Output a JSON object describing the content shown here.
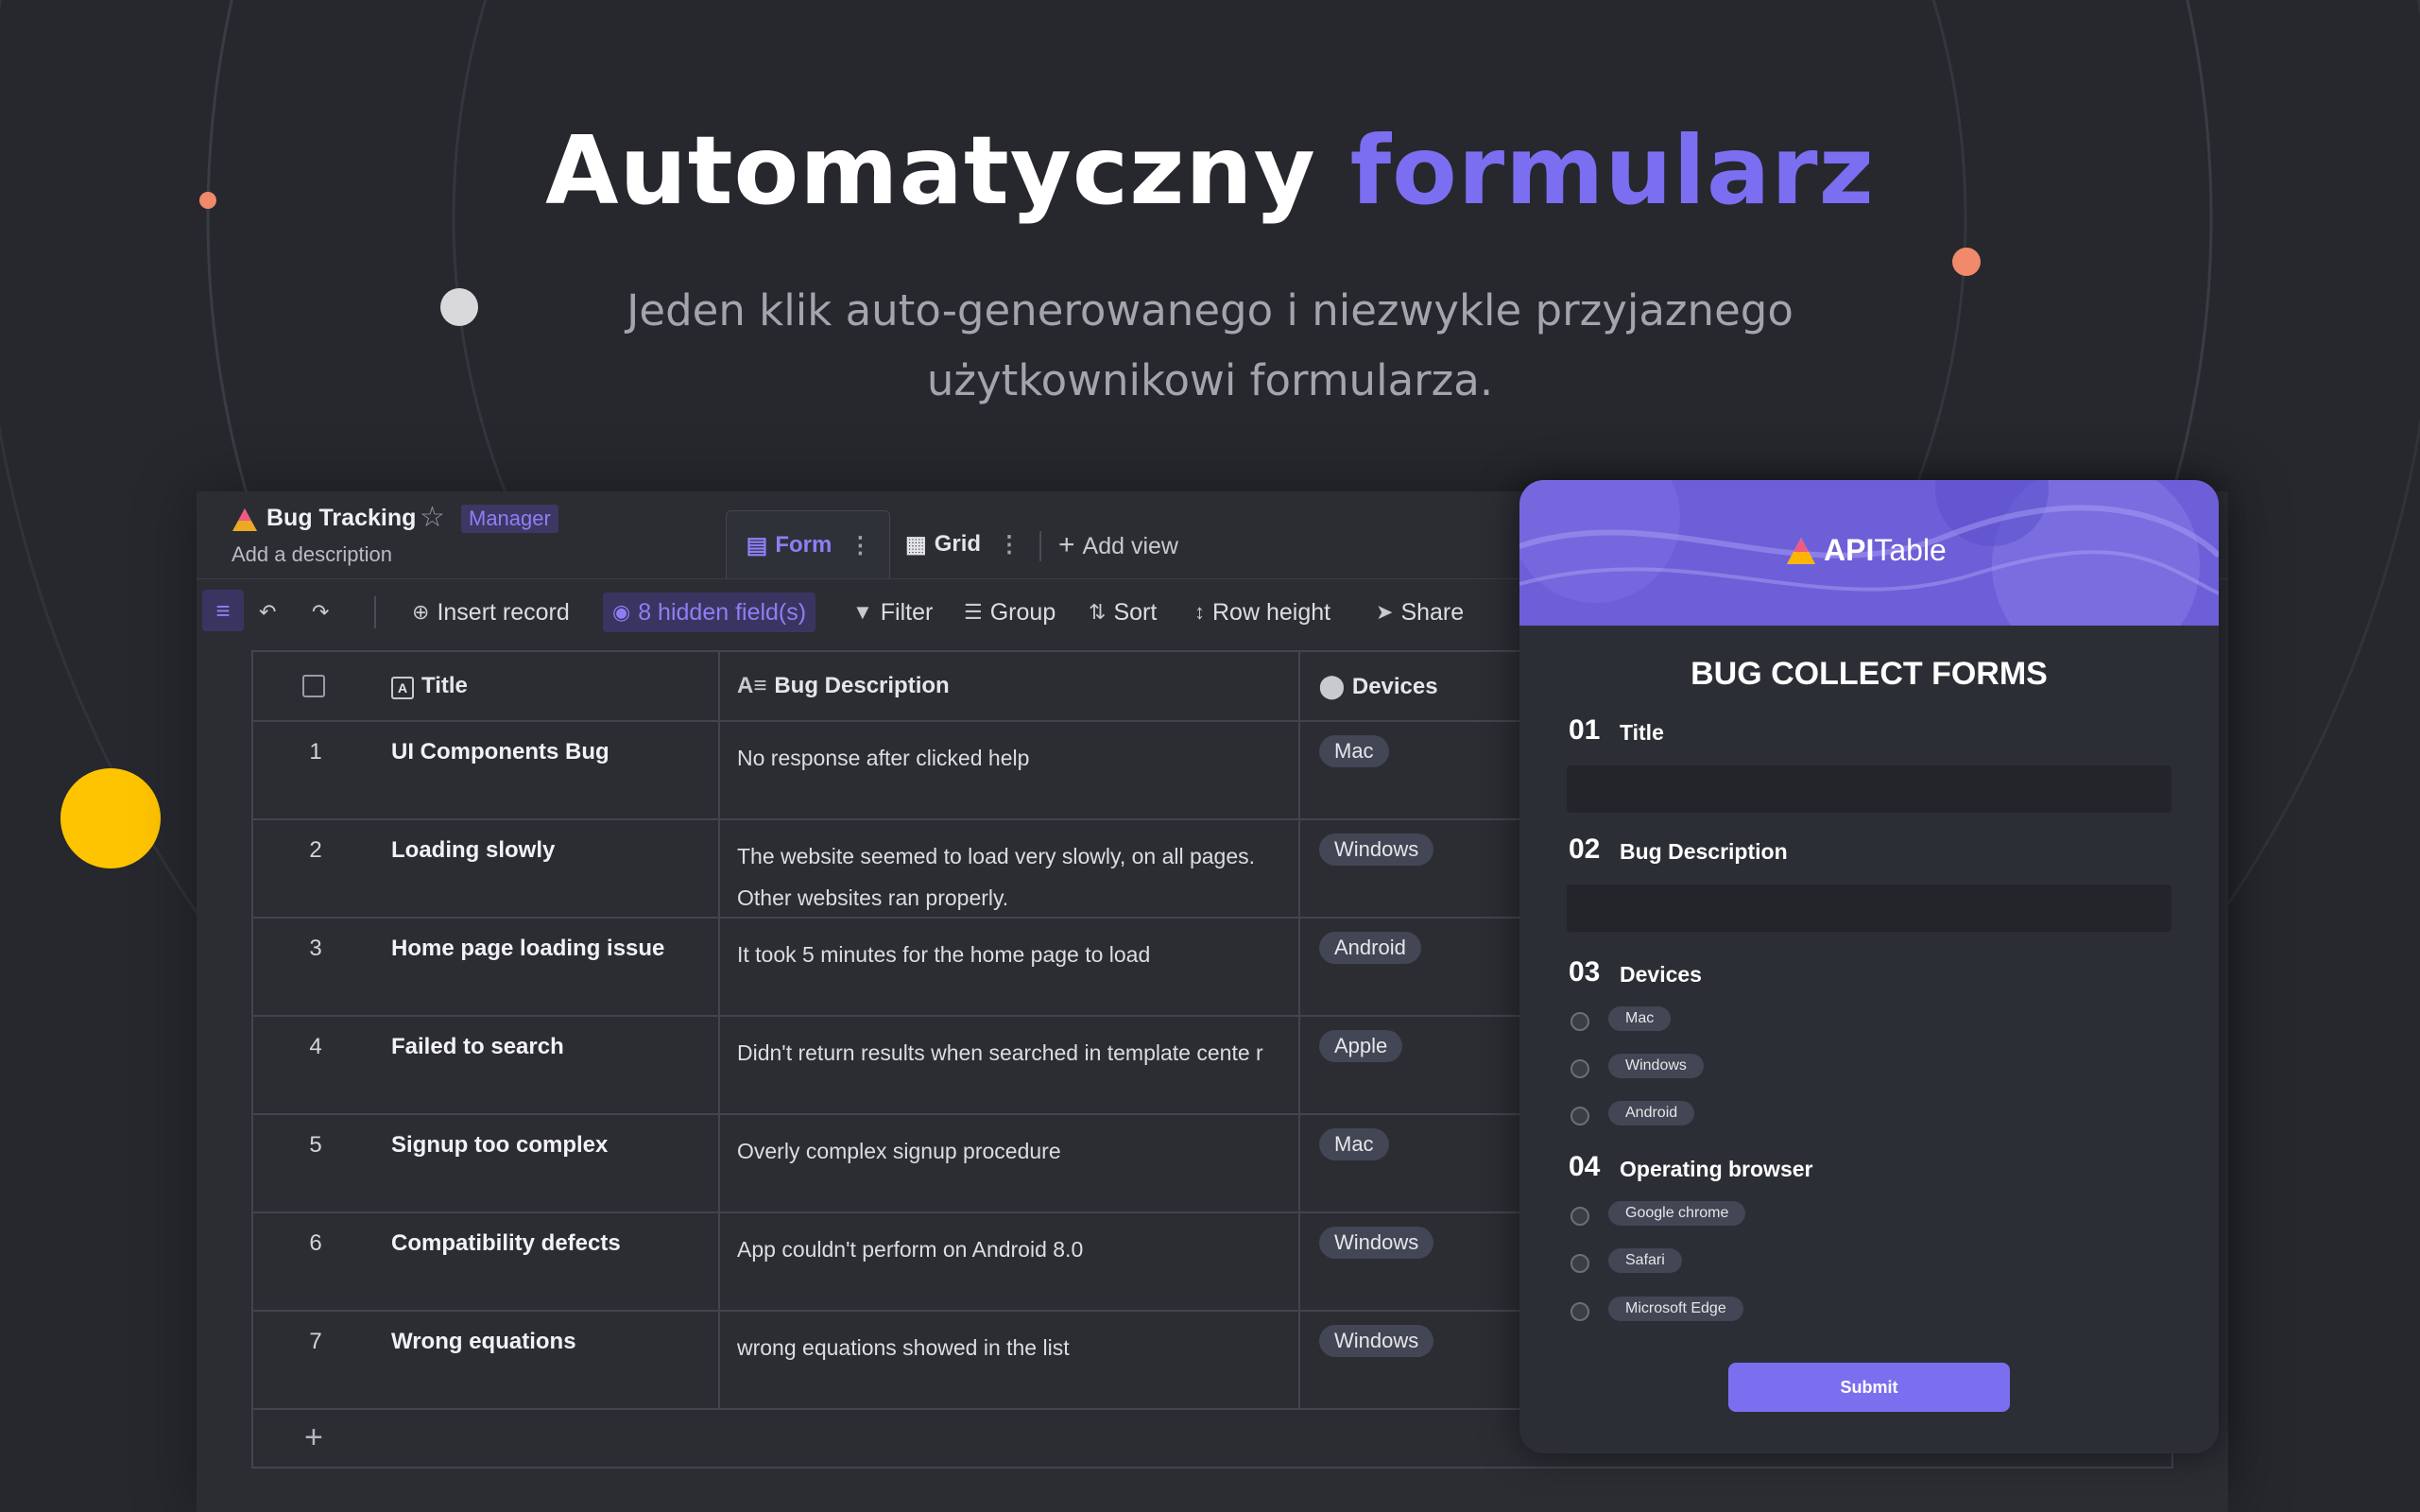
{
  "hero": {
    "title_main": "Automatyczny",
    "title_accent": "formularz",
    "subtitle_line1": "Jeden klik auto-generowanego i niezwykle przyjaznego",
    "subtitle_line2": "użytkownikowi formularza."
  },
  "colors": {
    "background": "#26282e",
    "accent": "#7c6ef0",
    "decor_yellow": "#ffc400",
    "decor_orange": "#f08a6a"
  },
  "datasheet": {
    "title": "Bug Tracking",
    "role": "Manager",
    "description": "Add a description",
    "views": [
      {
        "label": "Form",
        "icon": "form-icon",
        "active": true
      },
      {
        "label": "Grid",
        "icon": "grid-icon",
        "active": false
      }
    ],
    "add_view": "Add view"
  },
  "toolbar": {
    "insert_record": "Insert record",
    "hidden_fields": "8 hidden field(s)",
    "filter": "Filter",
    "group": "Group",
    "sort": "Sort",
    "row_height": "Row height",
    "share": "Share"
  },
  "grid": {
    "columns": [
      "Title",
      "Bug Description",
      "Devices"
    ],
    "rows": [
      {
        "num": "1",
        "title": "UI Components Bug",
        "desc": "No response after clicked help",
        "device": "Mac"
      },
      {
        "num": "2",
        "title": "Loading slowly",
        "desc": "The website seemed to load very slowly, on all pages.  Other websites ran properly.",
        "device": "Windows"
      },
      {
        "num": "3",
        "title": "Home page loading issue",
        "desc": "It took 5 minutes for the home page to load",
        "device": "Android"
      },
      {
        "num": "4",
        "title": "Failed to search",
        "desc": "Didn't return results when searched in template cente r",
        "device": "Apple"
      },
      {
        "num": "5",
        "title": "Signup too complex",
        "desc": "Overly complex signup procedure",
        "device": "Mac"
      },
      {
        "num": "6",
        "title": "Compatibility defects",
        "desc": "App couldn't perform on Android 8.0",
        "device": "Windows"
      },
      {
        "num": "7",
        "title": "Wrong equations",
        "desc": "wrong equations showed in the list",
        "device": "Windows"
      }
    ],
    "add_row": "+"
  },
  "form": {
    "brand_bold": "API",
    "brand_thin": "Table",
    "heading": "BUG COLLECT FORMS",
    "q1": {
      "num": "01",
      "label": "Title"
    },
    "q2": {
      "num": "02",
      "label": "Bug Description"
    },
    "q3": {
      "num": "03",
      "label": "Devices",
      "options": [
        "Mac",
        "Windows",
        "Android"
      ]
    },
    "q4": {
      "num": "04",
      "label": "Operating browser",
      "options": [
        "Google chrome",
        "Safari",
        "Microsoft Edge"
      ]
    },
    "submit": "Submit"
  }
}
